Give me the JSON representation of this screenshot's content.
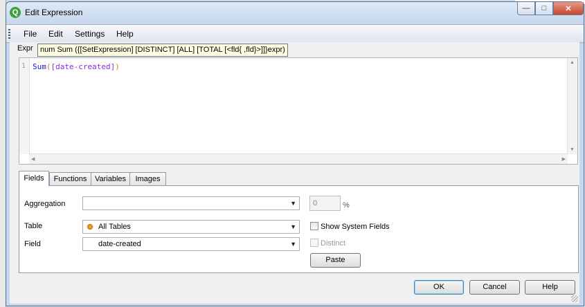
{
  "window": {
    "title": "Edit Expression",
    "app_icon_letter": "Q",
    "app_icon_color": "#3da13b",
    "minimize_glyph": "—",
    "maximize_glyph": "□",
    "close_glyph": "✕"
  },
  "menu": [
    "File",
    "Edit",
    "Settings",
    "Help"
  ],
  "expression": {
    "label": "Expr",
    "tooltip": "num Sum ({[SetExpression] [DISTINCT] [ALL] [TOTAL [<fld{ ,fld}>]]}expr)",
    "line_number": "1",
    "code": {
      "function": "Sum",
      "open_paren": "(",
      "field": "[date-created]",
      "close_paren": ")"
    }
  },
  "tabs": [
    "Fields",
    "Functions",
    "Variables",
    "Images"
  ],
  "fields_tab": {
    "aggregation_label": "Aggregation",
    "aggregation_value": "",
    "percent_value": "0",
    "percent_suffix": "%",
    "table_label": "Table",
    "table_value": "All Tables",
    "field_label": "Field",
    "field_value": "date-created",
    "show_system_fields_label": "Show System Fields",
    "distinct_label": "Distinct",
    "paste_label": "Paste"
  },
  "buttons": {
    "ok": "OK",
    "cancel": "Cancel",
    "help": "Help"
  }
}
